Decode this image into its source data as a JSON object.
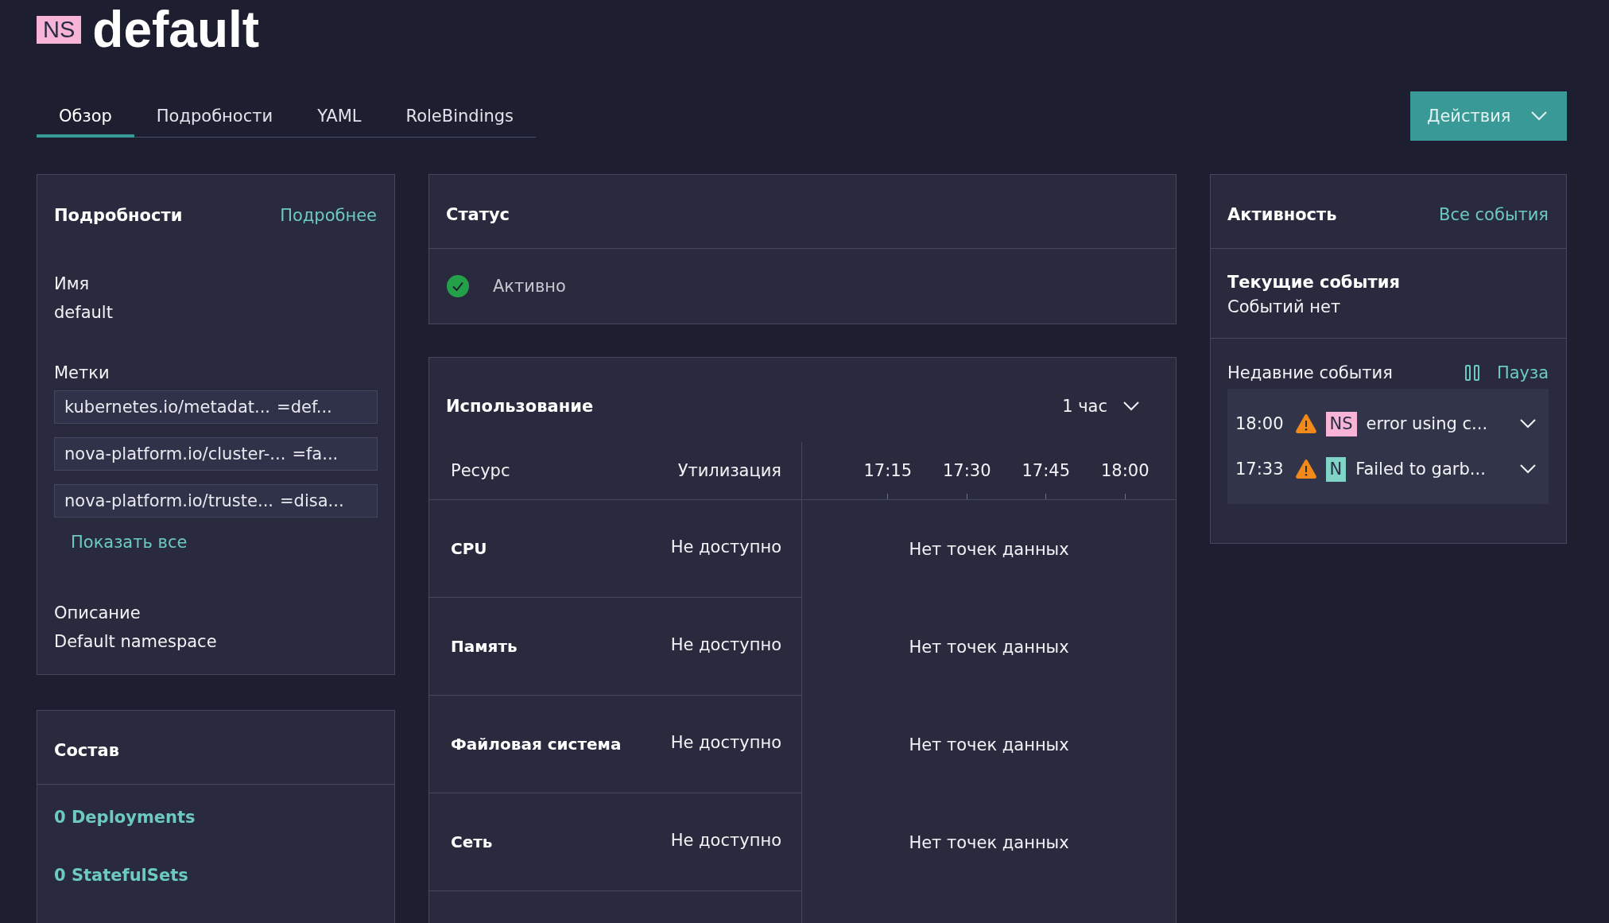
{
  "header": {
    "badge": "NS",
    "title": "default"
  },
  "tabs": [
    {
      "label": "Обзор",
      "selected": true
    },
    {
      "label": "Подробности",
      "selected": false
    },
    {
      "label": "YAML",
      "selected": false
    },
    {
      "label": "RoleBindings",
      "selected": false
    }
  ],
  "actions_button": {
    "label": "Действия"
  },
  "details": {
    "title": "Подробности",
    "link": "Подробнее",
    "sections": [
      {
        "kind": "field",
        "label": "Имя",
        "value": "default"
      },
      {
        "kind": "labels",
        "label": "Метки",
        "items": [
          {
            "key": "kubernetes.io/metadat...",
            "value": "=def..."
          },
          {
            "key": "nova-platform.io/cluster-...",
            "value": "=fa..."
          },
          {
            "key": "nova-platform.io/truste...",
            "value": "=disa..."
          }
        ],
        "link": "Показать все"
      },
      {
        "kind": "field",
        "label": "Описание",
        "value": "Default namespace"
      }
    ]
  },
  "composition": {
    "title": "Состав",
    "items": [
      "0 Deployments",
      "0 StatefulSets"
    ]
  },
  "status": {
    "title": "Статус",
    "kind": "success",
    "value": "Активно"
  },
  "usage": {
    "title": "Использование",
    "range": "1 час",
    "columns": [
      "Ресурс",
      "Утилизация"
    ],
    "time_ticks": [
      "17:15",
      "17:30",
      "17:45",
      "18:00"
    ],
    "rows": [
      {
        "resource": "CPU",
        "utilization": "Не доступно",
        "chart": "Нет точек данных"
      },
      {
        "resource": "Память",
        "utilization": "Не доступно",
        "chart": "Нет точек данных"
      },
      {
        "resource": "Файловая система",
        "utilization": "Не доступно",
        "chart": "Нет точек данных"
      },
      {
        "resource": "Сеть",
        "utilization": "Не доступно",
        "chart": "Нет точек данных"
      }
    ]
  },
  "activity": {
    "title": "Активность",
    "link": "Все события",
    "current": {
      "title": "Текущие события",
      "message": "Событий нет"
    },
    "recent": {
      "title": "Недавние события",
      "pause": "Пауза",
      "events": [
        {
          "time": "18:00",
          "kind": "warning",
          "badge": "NS",
          "color": "#f8b4d6",
          "message": "error using c..."
        },
        {
          "time": "17:33",
          "kind": "warning",
          "badge": "N",
          "color": "#7fd4c6",
          "message": "Failed to garb..."
        }
      ]
    }
  }
}
